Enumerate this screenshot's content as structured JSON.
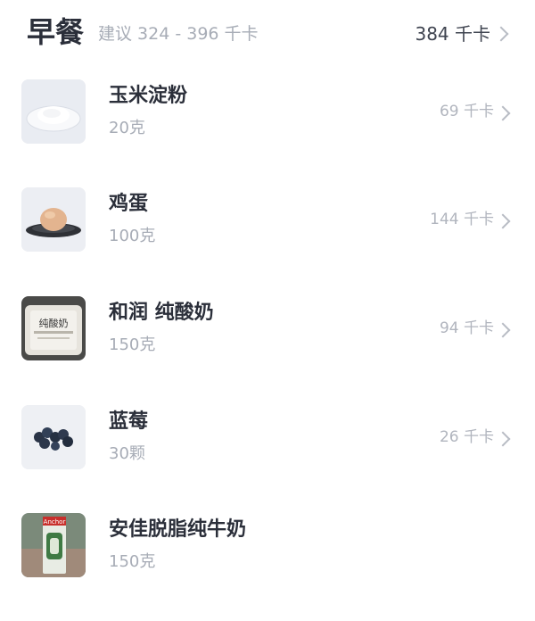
{
  "header": {
    "meal": "早餐",
    "suggestion": "建议 324 - 396 千卡",
    "total": "384 千卡"
  },
  "items": [
    {
      "name": "玉米淀粉",
      "amount": "20克",
      "kcal": "69 千卡",
      "image": "corn-starch-image"
    },
    {
      "name": "鸡蛋",
      "amount": "100克",
      "kcal": "144 千卡",
      "image": "egg-image"
    },
    {
      "name": "和润 纯酸奶",
      "amount": "150克",
      "kcal": "94 千卡",
      "image": "yogurt-cup-image",
      "package_text": "纯酸奶"
    },
    {
      "name": "蓝莓",
      "amount": "30颗",
      "kcal": "26 千卡",
      "image": "blueberries-image"
    },
    {
      "name": "安佳脱脂纯牛奶",
      "amount": "150克",
      "kcal": "",
      "image": "milk-carton-image",
      "package_text": "Anchor"
    }
  ]
}
